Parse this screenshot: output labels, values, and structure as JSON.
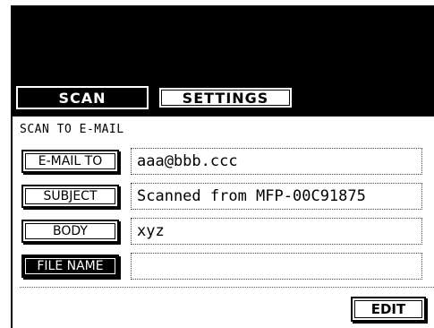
{
  "tabs": {
    "scan": "SCAN",
    "settings": "SETTINGS"
  },
  "section_title": "SCAN TO E-MAIL",
  "fields": [
    {
      "label": "E-MAIL TO",
      "value": "aaa@bbb.ccc"
    },
    {
      "label": "SUBJECT",
      "value": "Scanned from MFP-00C91875"
    },
    {
      "label": "BODY",
      "value": "xyz"
    },
    {
      "label": "FILE NAME",
      "value": ""
    }
  ],
  "edit_label": "EDIT",
  "colors": {
    "background": "#ffffff",
    "foreground": "#000000"
  }
}
